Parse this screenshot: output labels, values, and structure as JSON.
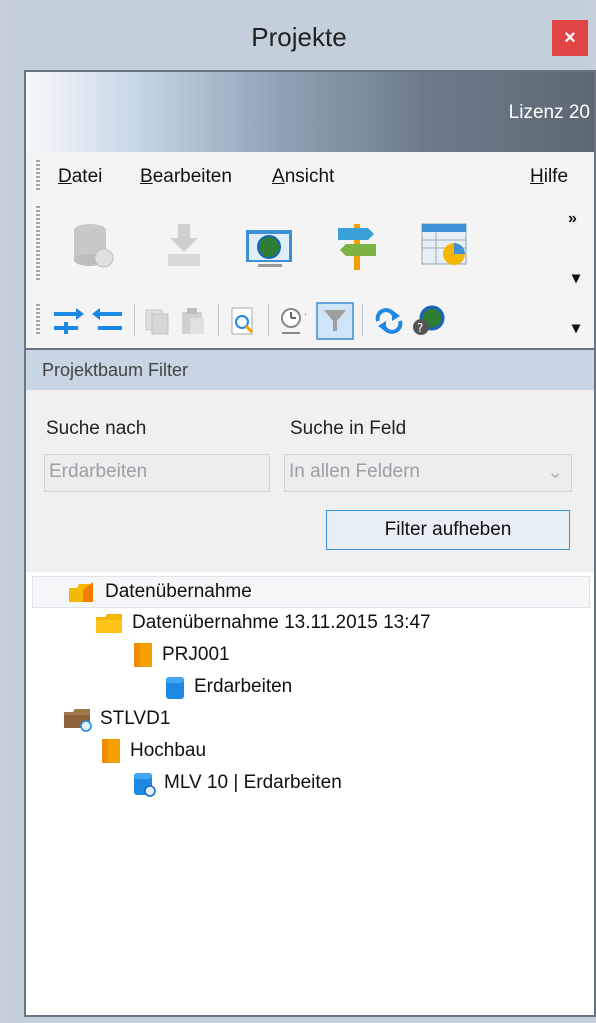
{
  "window": {
    "title": "Projekte",
    "close_label": "×"
  },
  "banner": {
    "license": "Lizenz 20"
  },
  "menu": [
    {
      "label": "Datei",
      "u": "D",
      "rest": "atei"
    },
    {
      "label": "Bearbeiten",
      "u": "B",
      "rest": "earbeiten"
    },
    {
      "label": "Ansicht",
      "u": "A",
      "rest": "nsicht"
    },
    {
      "label": "Hilfe",
      "u": "H",
      "rest": "ilfe"
    }
  ],
  "toolbar": {
    "overflow": "»",
    "dropdown": "▾",
    "large_icons": [
      "database-icon",
      "download-icon",
      "world-screen-icon",
      "signpost-icon",
      "chart-table-icon"
    ],
    "small_icons": [
      "indent-right-icon",
      "indent-left-icon",
      "copy-icon",
      "paste-icon",
      "preview-search-icon",
      "clock-icon",
      "filter-icon",
      "sync-icon",
      "globe-help-icon"
    ]
  },
  "filter": {
    "header": "Projektbaum Filter",
    "search_label": "Suche nach",
    "field_label": "Suche in Feld",
    "search_value": "Erdarbeiten",
    "field_value": "In allen Feldern",
    "clear_button": "Filter aufheben"
  },
  "tree": [
    {
      "label": "Datenübernahme",
      "icon": "folder-import-icon"
    },
    {
      "label": "Datenübernahme 13.11.2015 13:47",
      "icon": "folder-icon"
    },
    {
      "label": "PRJ001",
      "icon": "project-book-icon"
    },
    {
      "label": "Erdarbeiten",
      "icon": "blue-item-icon"
    },
    {
      "label": "STLVD1",
      "icon": "folder-link-icon"
    },
    {
      "label": "Hochbau",
      "icon": "project-book-icon"
    },
    {
      "label": "MLV 10 | Erdarbeiten",
      "icon": "blue-item-link-icon"
    }
  ],
  "colors": {
    "accent": "#3d8fd6",
    "close": "#e04444",
    "folder": "#f5b800"
  }
}
